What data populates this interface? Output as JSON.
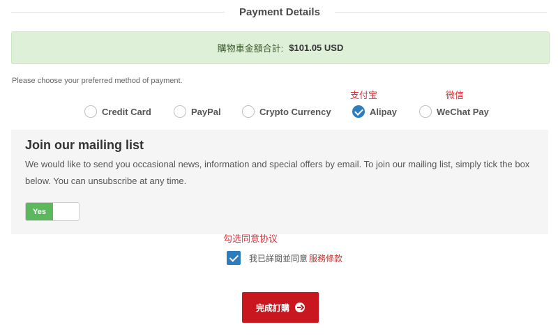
{
  "header": {
    "title": "Payment Details"
  },
  "total": {
    "label": "購物車金額合計:",
    "amount": "$101.05 USD"
  },
  "payment": {
    "instruction": "Please choose your preferred method of payment.",
    "methods": [
      {
        "label": "Credit Card",
        "selected": false
      },
      {
        "label": "PayPal",
        "selected": false
      },
      {
        "label": "Crypto Currency",
        "selected": false
      },
      {
        "label": "Alipay",
        "selected": true
      },
      {
        "label": "WeChat Pay",
        "selected": false
      }
    ],
    "notes": {
      "alipay": "支付宝",
      "wechat": "微信"
    }
  },
  "mailing": {
    "heading": "Join our mailing list",
    "description": "We would like to send you occasional news, information and special offers by email. To join our mailing list, simply tick the box below. You can unsubscribe at any time.",
    "toggle_label": "Yes",
    "toggle_on": true
  },
  "agreement": {
    "note": "勾选同意协议",
    "text": "我已詳閱並同意",
    "link": "服務條款",
    "checked": true
  },
  "submit": {
    "label": "完成訂購"
  },
  "colors": {
    "selected": "#2d7cbf",
    "banner": "#dff0d8",
    "note_red": "#e0323a",
    "submit": "#c8171f",
    "toggle_on": "#5cb85c"
  },
  "icons": {
    "submit": "arrow-circle-right-icon"
  }
}
